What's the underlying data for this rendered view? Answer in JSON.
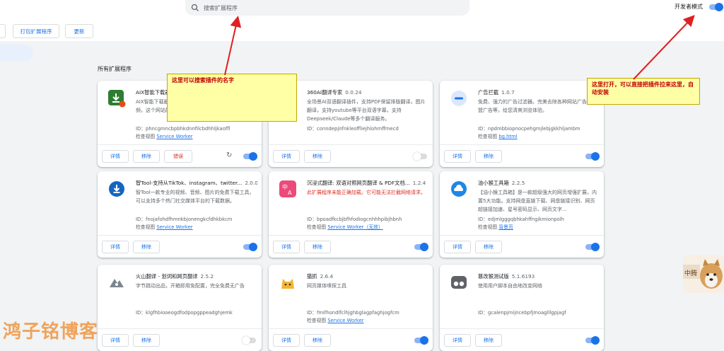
{
  "search": {
    "placeholder": "搜索扩展程序"
  },
  "header": {
    "dev_mode_label": "开发者模式",
    "dev_mode_on": true
  },
  "toolbar": {
    "pack_label": "打包扩展程序",
    "update_label": "更新"
  },
  "section_title": "所有扩展程序",
  "buttons": {
    "details": "详情",
    "remove": "移除",
    "errors": "错误"
  },
  "view_label": "检查视图",
  "cards": [
    {
      "name": "AIX智能下载器",
      "version": "",
      "desc": "AIX智能下载器，视频、音频等一键下载网页中的视频，这个网站的智能...",
      "id": "ID：phncgmncbpbhkdnnfilcbdhhljkaoffl",
      "view_link": "Service Worker",
      "on": true,
      "icon": "download-icon"
    },
    {
      "name": "360AI翻译专家",
      "version": "0.0.24",
      "desc": "全场景AI双语翻译插件，支持PDF保留排版翻译，图片翻译，支持youtube等平台双语字幕，支持Deepseek/Claude等多个翻译服务。",
      "id": "ID：conndepjnfnkleoffliejhlohmffmecd",
      "view_link": "",
      "on": false,
      "icon": "translate-icon"
    },
    {
      "name": "广告拦截",
      "version": "1.0.7",
      "desc": "免费、强力的广告过滤器。完美去除各种网站广告，联盟广告等，给您清爽浏览体验。",
      "id": "ID：npdmbbiopnocpehgmjlebjgkkhljambm",
      "view_link": "bg.html",
      "on": true,
      "icon": "block-icon"
    },
    {
      "name": "智Tool-支持从TikTok、instagram、twitter...",
      "version": "2.0.0",
      "desc": "智Tool一款专业的视频、音频、图片的免费下载工具，可以支持多个热门社交媒体平台的下载数据。",
      "id": "ID：fnojafohdfhmnkbjonengkcfdhkbkcm",
      "view_link": "Service Worker",
      "on": true,
      "icon": "download-icon"
    },
    {
      "name": "沉浸式翻译: 双语对照网页翻译 & PDF文档...",
      "version": "1.2.4",
      "desc": "此扩展程序未能正确加载。它可能无法拦截网络请求。",
      "id": "ID：bpoadfkcbjbfhfodiogcnhhhpibjhbnh",
      "view_link": "Service Worker（无效）",
      "on": true,
      "icon": "translate-icon"
    },
    {
      "name": "油小猴工具箱",
      "version": "2.2.5",
      "desc": "【油小猴工具箱】是一款超级强大的网页增强扩展，内置5大功能。支持网盘直链下载、网盘链接识别、网页超链接加速、星号密码显示、网页文字...",
      "id": "ID：edjmlgggqbhkahffngikmionpolh",
      "view_link": "背景页",
      "on": true,
      "icon": "cloud-icon"
    },
    {
      "name": "火山翻译 - 划词和网页翻译",
      "version": "2.5.2",
      "desc": "字节跳动出品，开箱即用免配置，完全免费无广告",
      "id": "ID：klgfhbiooeogdfodpopgppeadghjemk",
      "view_link": "",
      "on": false,
      "icon": "mountain-icon"
    },
    {
      "name": "猫抓",
      "version": "2.6.4",
      "desc": "网页媒体嗅探工具",
      "id": "ID：fmifhondlfclhjghbglagpfaghjogfcm",
      "view_link": "Service Worker",
      "on": true,
      "icon": "cat-icon"
    },
    {
      "name": "篡改猴测试版",
      "version": "5.1.6193",
      "desc": "使用用户脚本自由地改变网络",
      "id": "ID：gcalenpjmijncebpfjmoaglllgpjagf",
      "view_link": "",
      "on": true,
      "icon": "monkey-icon"
    }
  ],
  "notes": {
    "search_note": "这里可以搜索插件的名字",
    "dev_note": "这里打开，可以直接把插件拉来这里，自动安装"
  },
  "watermark": "鸿子铭博客",
  "dog_label": "中腾"
}
